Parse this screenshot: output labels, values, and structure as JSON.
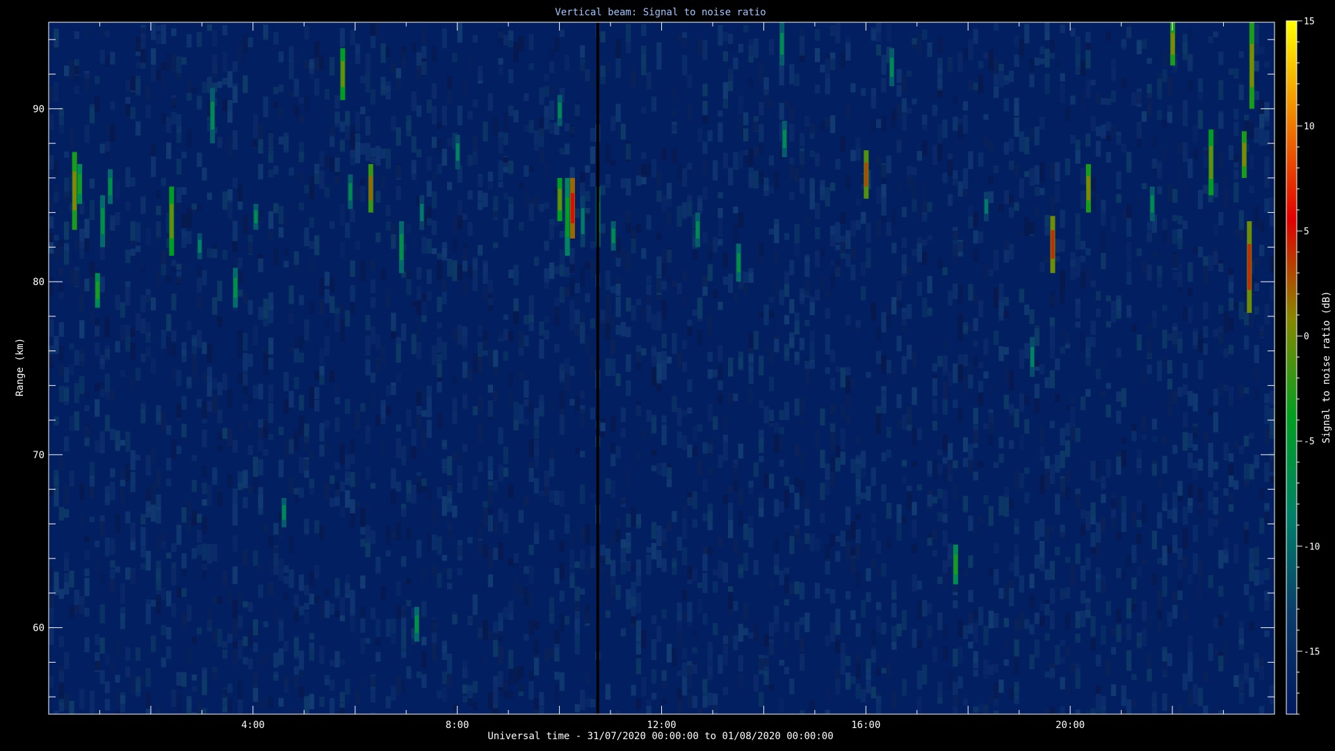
{
  "chart_data": {
    "type": "heatmap",
    "title": "Vertical beam: Signal to noise ratio",
    "xlabel": "Universal time - 31/07/2020 00:00:00 to 01/08/2020 00:00:00",
    "ylabel": "Range (km)",
    "colorbar_label": "Signal to noise ratio (dB)",
    "xlim_hours": [
      0,
      24
    ],
    "x_ticks": [
      {
        "value": 4,
        "label": "4:00"
      },
      {
        "value": 8,
        "label": "8:00"
      },
      {
        "value": 12,
        "label": "12:00"
      },
      {
        "value": 16,
        "label": "16:00"
      },
      {
        "value": 20,
        "label": "20:00"
      }
    ],
    "ylim": [
      55,
      95
    ],
    "y_ticks": [
      {
        "value": 60,
        "label": "60"
      },
      {
        "value": 70,
        "label": "70"
      },
      {
        "value": 80,
        "label": "80"
      },
      {
        "value": 90,
        "label": "90"
      }
    ],
    "clim": [
      -18,
      15
    ],
    "c_ticks": [
      {
        "value": 15,
        "label": "15"
      },
      {
        "value": 10,
        "label": "10"
      },
      {
        "value": 5,
        "label": "5"
      },
      {
        "value": 0,
        "label": "0"
      },
      {
        "value": -5,
        "label": "-5"
      },
      {
        "value": -10,
        "label": "-10"
      },
      {
        "value": -15,
        "label": "-15"
      }
    ],
    "colormap": [
      "#001860",
      "#0a3a6a",
      "#00806a",
      "#00a020",
      "#888800",
      "#e00000",
      "#f08000",
      "#ffff00"
    ],
    "background_snr": -17,
    "data_gap_hours": 10.75,
    "echoes": [
      {
        "t": 0.5,
        "r0": 83,
        "r1": 87.5,
        "snr": 1
      },
      {
        "t": 0.6,
        "r0": 84.5,
        "r1": 86.8,
        "snr": -3
      },
      {
        "t": 0.95,
        "r0": 78.5,
        "r1": 80.5,
        "snr": -3
      },
      {
        "t": 1.05,
        "r0": 82,
        "r1": 85,
        "snr": -6
      },
      {
        "t": 1.2,
        "r0": 84.5,
        "r1": 86.5,
        "snr": -6
      },
      {
        "t": 2.4,
        "r0": 81.5,
        "r1": 85.5,
        "snr": 0
      },
      {
        "t": 2.95,
        "r0": 81.3,
        "r1": 82.8,
        "snr": -8
      },
      {
        "t": 3.2,
        "r0": 88,
        "r1": 91.2,
        "snr": -7
      },
      {
        "t": 3.65,
        "r0": 78.5,
        "r1": 80.8,
        "snr": -6
      },
      {
        "t": 4.05,
        "r0": 83,
        "r1": 84.5,
        "snr": -7
      },
      {
        "t": 4.6,
        "r0": 65.8,
        "r1": 67.5,
        "snr": -7
      },
      {
        "t": 5.75,
        "r0": 90.5,
        "r1": 93.5,
        "snr": 0
      },
      {
        "t": 5.9,
        "r0": 84.2,
        "r1": 86.2,
        "snr": -7
      },
      {
        "t": 6.3,
        "r0": 84,
        "r1": 86.8,
        "snr": 2
      },
      {
        "t": 6.9,
        "r0": 80.5,
        "r1": 83.5,
        "snr": -6
      },
      {
        "t": 7.2,
        "r0": 59.2,
        "r1": 61.2,
        "snr": -6
      },
      {
        "t": 7.3,
        "r0": 83,
        "r1": 85,
        "snr": -9
      },
      {
        "t": 8.0,
        "r0": 86.5,
        "r1": 88.5,
        "snr": -8
      },
      {
        "t": 10.0,
        "r0": 89,
        "r1": 90.8,
        "snr": -7
      },
      {
        "t": 10.0,
        "r0": 83.5,
        "r1": 86,
        "snr": 0
      },
      {
        "t": 10.15,
        "r0": 81.5,
        "r1": 86,
        "snr": -4
      },
      {
        "t": 10.25,
        "r0": 82.5,
        "r1": 86,
        "snr": 6
      },
      {
        "t": 10.45,
        "r0": 82,
        "r1": 85,
        "snr": -9
      },
      {
        "t": 10.75,
        "r0": 82,
        "r1": 85.5,
        "snr": -7
      },
      {
        "t": 11.05,
        "r0": 81.8,
        "r1": 83.5,
        "snr": -7
      },
      {
        "t": 12.7,
        "r0": 82,
        "r1": 84,
        "snr": -7
      },
      {
        "t": 13.5,
        "r0": 80,
        "r1": 82.2,
        "snr": -6
      },
      {
        "t": 14.35,
        "r0": 92.5,
        "r1": 95,
        "snr": -7
      },
      {
        "t": 14.4,
        "r0": 87.2,
        "r1": 89.3,
        "snr": -7
      },
      {
        "t": 16.0,
        "r0": 84.8,
        "r1": 87.6,
        "snr": 3
      },
      {
        "t": 16.5,
        "r0": 91.3,
        "r1": 93.5,
        "snr": -7
      },
      {
        "t": 17.75,
        "r0": 62.5,
        "r1": 64.8,
        "snr": -3
      },
      {
        "t": 18.35,
        "r0": 83.5,
        "r1": 85.2,
        "snr": -9
      },
      {
        "t": 19.25,
        "r0": 74.5,
        "r1": 76.8,
        "snr": -8
      },
      {
        "t": 19.65,
        "r0": 80.5,
        "r1": 83.8,
        "snr": 4
      },
      {
        "t": 20.35,
        "r0": 84,
        "r1": 86.8,
        "snr": 1
      },
      {
        "t": 21.6,
        "r0": 83.5,
        "r1": 85.5,
        "snr": -7
      },
      {
        "t": 22.0,
        "r0": 92.5,
        "r1": 95,
        "snr": 1
      },
      {
        "t": 22.75,
        "r0": 85,
        "r1": 88.8,
        "snr": 0
      },
      {
        "t": 23.4,
        "r0": 86,
        "r1": 88.7,
        "snr": 1
      },
      {
        "t": 23.5,
        "r0": 78.2,
        "r1": 83.5,
        "snr": 4
      },
      {
        "t": 23.55,
        "r0": 90,
        "r1": 95,
        "snr": 1
      }
    ]
  }
}
